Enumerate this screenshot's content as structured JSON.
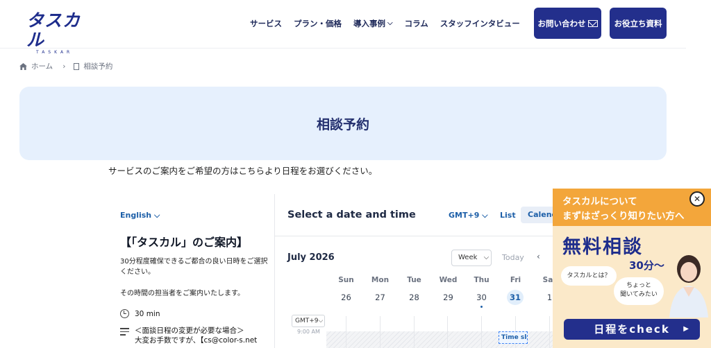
{
  "header": {
    "logo_text": "タスカル",
    "logo_sub": "TASKAR",
    "nav": [
      {
        "label": "サービス"
      },
      {
        "label": "プラン・価格"
      },
      {
        "label": "導入事例",
        "has_dropdown": true
      },
      {
        "label": "コラム"
      },
      {
        "label": "スタッフインタビュー"
      }
    ],
    "contact_button": "お問い合わせ",
    "docs_button": "お役立ち資料"
  },
  "breadcrumb": {
    "home": "ホーム",
    "current": "相談予約"
  },
  "page_title": "相談予約",
  "intro": "サービスのご案内をご希望の方はこちらより日程をお選びください。",
  "booking": {
    "language": "English",
    "event_title": "【「タスカル」のご案内】",
    "description1": "30分程度確保できるご都合の良い日時をご選択ください。",
    "description2": "その時間の担当者をご案内いたします。",
    "duration": "30 min",
    "note_line1": "＜面談日程の変更が必要な場合＞",
    "note_line2": "大変お手数ですが、【cs@color-s.net",
    "select_title": "Select a date and time",
    "timezone": "GMT+9",
    "view_list": "List",
    "view_calendar": "Calendar",
    "month": "July 2026",
    "range_select": "Week",
    "today": "Today",
    "days": [
      {
        "name": "Sun",
        "date": "26"
      },
      {
        "name": "Mon",
        "date": "27"
      },
      {
        "name": "Tue",
        "date": "28"
      },
      {
        "name": "Wed",
        "date": "29"
      },
      {
        "name": "Thu",
        "date": "30"
      },
      {
        "name": "Fri",
        "date": "31"
      },
      {
        "name": "Sat",
        "date": "1"
      }
    ],
    "tz_select": "GMT+9",
    "time_label": "9:00 AM",
    "slot_label": "Time slot"
  },
  "promo": {
    "line1": "タスカルについて",
    "line2": "まずはざっくり知りたい方へ",
    "headline": "無料相談",
    "minutes": "30分〜",
    "bubble1": "タスカルとは？",
    "bubble2_line1": "ちょっと",
    "bubble2_line2": "聞いてみたい",
    "cta": "日程をcheck",
    "accent": "#f3a63b",
    "navy": "#1e2d8c"
  }
}
